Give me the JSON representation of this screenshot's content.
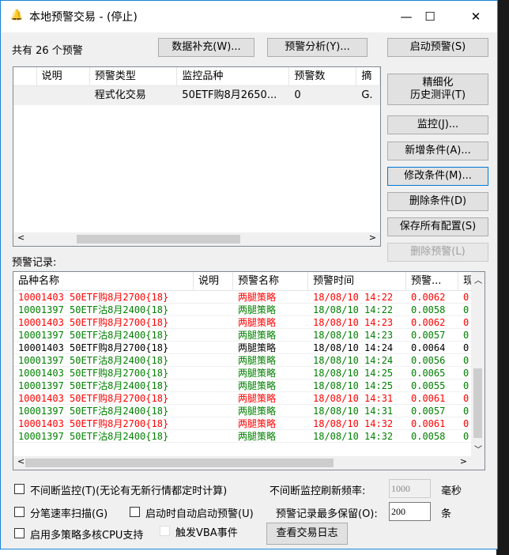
{
  "title": "本地预警交易 - (停止)",
  "count_label": "共有 26 个预警",
  "buttons": {
    "data_supplement": "数据补充(W)...",
    "alert_analysis": "预警分析(Y)...",
    "start_alert": "启动预警(S)",
    "refined_backtest_1": "精细化",
    "refined_backtest_2": "历史测评(T)",
    "monitor": "监控(J)...",
    "add_condition": "新增条件(A)...",
    "modify_condition": "修改条件(M)...",
    "delete_condition": "删除条件(D)",
    "save_all": "保存所有配置(S)",
    "delete_alert": "删除预警(L)",
    "view_log": "查看交易日志"
  },
  "alert_table": {
    "headers": [
      "说明",
      "预警类型",
      "监控品种",
      "预警数",
      "摘"
    ],
    "rows": [
      {
        "note": "",
        "type": "程式化交易",
        "symbol": "50ETF购8月2650...",
        "count": "0",
        "extra": "G."
      }
    ]
  },
  "records_label": "预警记录:",
  "records": {
    "headers": [
      "品种名称",
      "说明",
      "预警名称",
      "预警时间",
      "预警...",
      "现"
    ],
    "rows": [
      {
        "name": "10001403 50ETF购8月2700{18}",
        "note": "",
        "alert": "两腿策略",
        "time": "18/08/10 14:22",
        "value": "0.0062",
        "last": "0",
        "color": "#ff0000"
      },
      {
        "name": "10001397 50ETF沽8月2400{18}",
        "note": "",
        "alert": "两腿策略",
        "time": "18/08/10 14:22",
        "value": "0.0058",
        "last": "0",
        "color": "#008000"
      },
      {
        "name": "10001403 50ETF购8月2700{18}",
        "note": "",
        "alert": "两腿策略",
        "time": "18/08/10 14:23",
        "value": "0.0062",
        "last": "0",
        "color": "#ff0000"
      },
      {
        "name": "10001397 50ETF沽8月2400{18}",
        "note": "",
        "alert": "两腿策略",
        "time": "18/08/10 14:23",
        "value": "0.0057",
        "last": "0",
        "color": "#008000"
      },
      {
        "name": "10001403 50ETF购8月2700{18}",
        "note": "",
        "alert": "两腿策略",
        "time": "18/08/10 14:24",
        "value": "0.0064",
        "last": "0",
        "color": "#000000"
      },
      {
        "name": "10001397 50ETF沽8月2400{18}",
        "note": "",
        "alert": "两腿策略",
        "time": "18/08/10 14:24",
        "value": "0.0056",
        "last": "0",
        "color": "#008000"
      },
      {
        "name": "10001403 50ETF购8月2700{18}",
        "note": "",
        "alert": "两腿策略",
        "time": "18/08/10 14:25",
        "value": "0.0065",
        "last": "0",
        "color": "#008000"
      },
      {
        "name": "10001397 50ETF沽8月2400{18}",
        "note": "",
        "alert": "两腿策略",
        "time": "18/08/10 14:25",
        "value": "0.0055",
        "last": "0",
        "color": "#008000"
      },
      {
        "name": "10001403 50ETF购8月2700{18}",
        "note": "",
        "alert": "两腿策略",
        "time": "18/08/10 14:31",
        "value": "0.0061",
        "last": "0",
        "color": "#ff0000"
      },
      {
        "name": "10001397 50ETF沽8月2400{18}",
        "note": "",
        "alert": "两腿策略",
        "time": "18/08/10 14:31",
        "value": "0.0057",
        "last": "0",
        "color": "#008000"
      },
      {
        "name": "10001403 50ETF购8月2700{18}",
        "note": "",
        "alert": "两腿策略",
        "time": "18/08/10 14:32",
        "value": "0.0061",
        "last": "0",
        "color": "#ff0000"
      },
      {
        "name": "10001397 50ETF沽8月2400{18}",
        "note": "",
        "alert": "两腿策略",
        "time": "18/08/10 14:32",
        "value": "0.0058",
        "last": "0",
        "color": "#008000"
      }
    ]
  },
  "options": {
    "continuous": "不间断监控(T)(无论有无新行情都定时计算)",
    "refresh_label": "不间断监控刷新频率:",
    "refresh_value": "1000",
    "refresh_unit": "毫秒",
    "tick_scan": "分笔速率扫描(G)",
    "auto_start": "启动时自动启动预警(U)",
    "max_keep_label": "预警记录最多保留(O):",
    "max_keep_value": "200",
    "max_keep_unit": "条",
    "multicore": "启用多策略多核CPU支持",
    "vba": "触发VBA事件"
  }
}
